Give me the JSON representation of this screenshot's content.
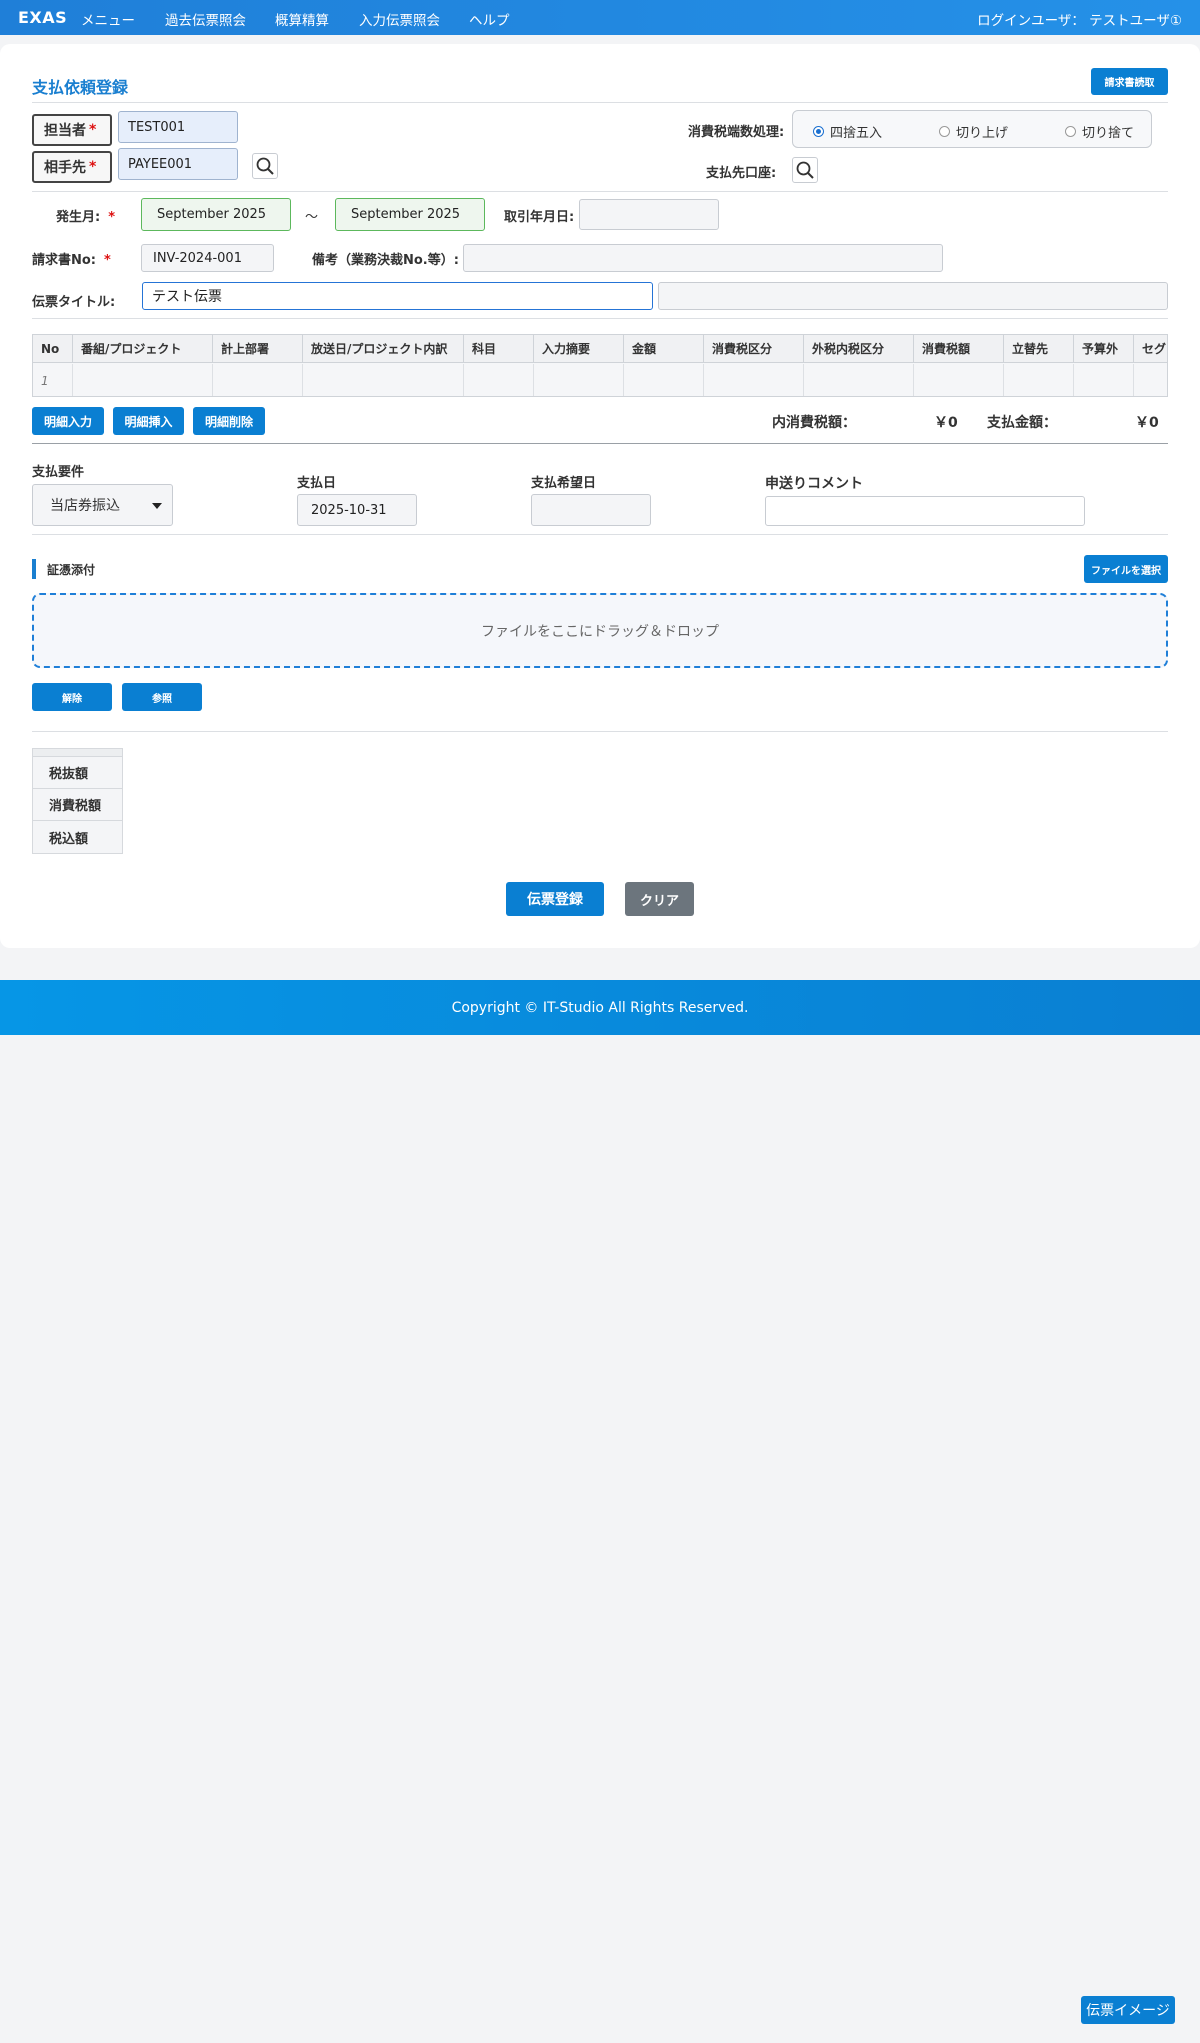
{
  "nav": {
    "brand": "EXAS",
    "items": [
      "メニュー",
      "過去伝票照会",
      "概算精算",
      "入力伝票照会",
      "ヘルプ"
    ],
    "user": "ログインユーザ： テストユーザ①"
  },
  "page": {
    "title": "支払依頼登録",
    "invoice_read_button": "請求書読取"
  },
  "header": {
    "staff_label": "担当者",
    "staff_value": "TEST001",
    "partner_label": "相手先",
    "partner_value": "PAYEE001",
    "required_mark": "*",
    "tax_rounding_label": "消費税端数処理:",
    "tax_rounding_options": [
      "四捨五入",
      "切り上げ",
      "切り捨て"
    ],
    "tax_rounding_selected": "四捨五入",
    "payee_account_label": "支払先口座:"
  },
  "form": {
    "occurrence_label": "発生月:",
    "occurrence_from": "September 2025",
    "tilde": "～",
    "occurrence_to": "September 2025",
    "trade_date_label": "取引年月日:",
    "trade_date_value": "",
    "invoice_no_label": "請求書No:",
    "invoice_no_value": "INV-2024-001",
    "remarks_label": "備考（業務決裁No.等）:",
    "remarks_value": "",
    "voucher_title_label": "伝票タイトル:",
    "voucher_title_value": "テスト伝票",
    "voucher_title_extra": ""
  },
  "table": {
    "columns": [
      "No",
      "番組/プロジェクト",
      "計上部署",
      "放送日/プロジェクト内訳",
      "科目",
      "入力摘要",
      "金額",
      "消費税区分",
      "外税内税区分",
      "消費税額",
      "立替先",
      "予算外",
      "セグ"
    ],
    "rows": [
      [
        "1",
        "",
        "",
        "",
        "",
        "",
        "",
        "",
        "",
        "",
        "",
        "",
        ""
      ]
    ]
  },
  "detail_buttons": [
    "明細入力",
    "明細挿入",
    "明細削除"
  ],
  "totals": {
    "inner_tax_label": "内消費税額：",
    "inner_tax_value": "￥0",
    "payment_label": "支払金額：",
    "payment_value": "￥0"
  },
  "payment": {
    "condition_label": "支払要件",
    "condition_value": "当店券振込",
    "date_label": "支払日",
    "date_value": "2025-10-31",
    "desired_date_label": "支払希望日",
    "desired_date_value": "",
    "comment_label": "申送りコメント",
    "comment_value": ""
  },
  "attachment": {
    "section_label": "証憑添付",
    "choose_file_button": "ファイルを選択",
    "drop_text": "ファイルをここにドラッグ＆ドロップ",
    "delete_button": "解除",
    "view_button": "参照"
  },
  "summary": {
    "rows": [
      "税抜額",
      "消費税額",
      "税込額"
    ]
  },
  "actions": {
    "register": "伝票登録",
    "clear": "クリア",
    "voucher_image": "伝票イメージ"
  },
  "footer": {
    "copyright": "Copyright © IT-Studio All Rights Reserved."
  },
  "colors": {
    "primary": "#0a7fd2",
    "nav": "#1f7fd8",
    "required": "#dd1111",
    "clear_button": "#6c757d"
  }
}
